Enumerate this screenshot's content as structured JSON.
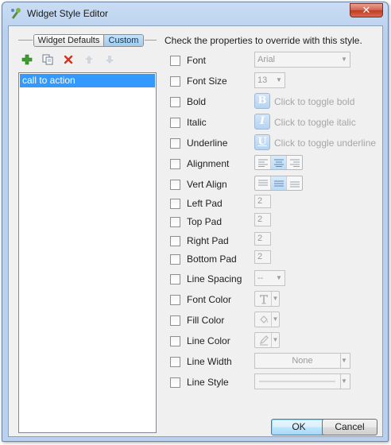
{
  "window": {
    "title": "Widget Style Editor",
    "close_glyph": "✕"
  },
  "left": {
    "segments": {
      "defaults": "Widget Defaults",
      "custom": "Custom",
      "selected": "Custom"
    },
    "toolbar": [
      "add-icon",
      "copy-icon",
      "delete-icon",
      "move-up-icon",
      "move-down-icon"
    ],
    "styles": [
      {
        "label": "call to action",
        "selected": true
      }
    ]
  },
  "right": {
    "header": "Check the properties to override with this style.",
    "properties": {
      "font": {
        "label": "Font",
        "value": "Arial"
      },
      "font_size": {
        "label": "Font Size",
        "value": "13"
      },
      "bold": {
        "label": "Bold",
        "icon_letter": "B",
        "hint": "Click to toggle bold"
      },
      "italic": {
        "label": "Italic",
        "icon_letter": "I",
        "hint": "Click to toggle italic"
      },
      "underline": {
        "label": "Underline",
        "icon_letter": "U",
        "hint": "Click to toggle underline"
      },
      "alignment": {
        "label": "Alignment",
        "options": [
          "left",
          "center",
          "right"
        ],
        "selected": "center"
      },
      "vert_align": {
        "label": "Vert Align",
        "options": [
          "top",
          "middle",
          "bottom"
        ],
        "selected": "middle"
      },
      "left_pad": {
        "label": "Left Pad",
        "value": "2"
      },
      "top_pad": {
        "label": "Top Pad",
        "value": "2"
      },
      "right_pad": {
        "label": "Right Pad",
        "value": "2"
      },
      "bottom_pad": {
        "label": "Bottom Pad",
        "value": "2"
      },
      "line_spacing": {
        "label": "Line Spacing",
        "value": "--"
      },
      "font_color": {
        "label": "Font Color",
        "icon": "font-color-icon"
      },
      "fill_color": {
        "label": "Fill Color",
        "icon": "fill-bucket-icon"
      },
      "line_color": {
        "label": "Line Color",
        "icon": "pencil-icon"
      },
      "line_width": {
        "label": "Line Width",
        "value": "None"
      },
      "line_style": {
        "label": "Line Style",
        "icon": "line-style-icon"
      }
    }
  },
  "buttons": {
    "ok": "OK",
    "cancel": "Cancel"
  },
  "colors": {
    "selection": "#3399ff",
    "toggle_icon": "#b7d3f0",
    "disabled_text": "#a6a6a6"
  }
}
